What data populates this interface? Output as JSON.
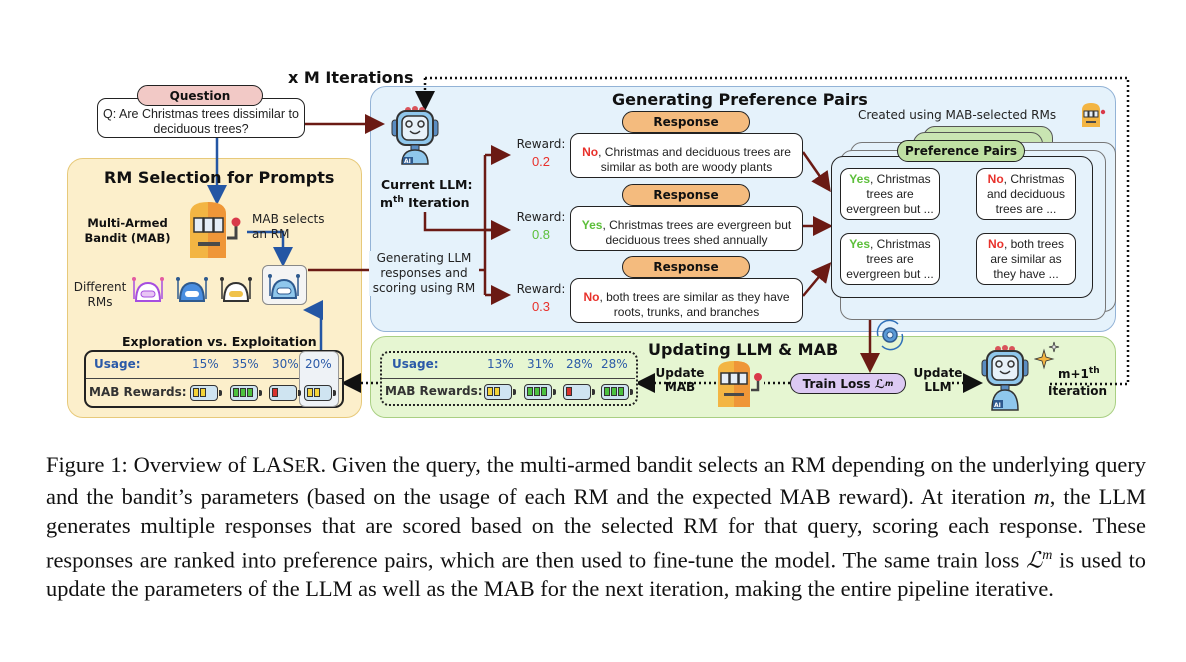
{
  "figure": {
    "loop_label": "x M Iterations",
    "question": {
      "header": "Question",
      "text": "Q: Are Christmas trees dissimilar to deciduous trees?"
    },
    "rm_selection": {
      "title": "RM Selection for Prompts",
      "mab_label": "Multi-Armed Bandit (MAB)",
      "mab_selects": "MAB selects an RM",
      "different_rms": "Different RMs",
      "tradeoff_title": "Exploration vs. Exploitation",
      "usage_label": "Usage:",
      "rewards_label": "MAB Rewards:",
      "usage": [
        "15%",
        "35%",
        "30%",
        "20%"
      ],
      "reward_levels": [
        2,
        3,
        1,
        2
      ],
      "selected_index": 3
    },
    "generation": {
      "title": "Generating Preference Pairs",
      "current_llm_line1": "Current LLM:",
      "current_llm_line2": "m",
      "current_llm_sup": "th",
      "current_llm_line3": " Iteration",
      "generating_label": "Generating LLM responses and scoring using RM",
      "reward_label": "Reward:",
      "responses": [
        {
          "header": "Response",
          "verdict": "No",
          "rest": ", Christmas and deciduous trees are similar as both are woody plants",
          "reward": "0.2",
          "reward_color": "#e8312b"
        },
        {
          "header": "Response",
          "verdict": "Yes",
          "rest": ", Christmas trees are evergreen but deciduous trees shed annually",
          "reward": "0.8",
          "reward_color": "#5cbf3a"
        },
        {
          "header": "Response",
          "verdict": "No",
          "rest": ", both trees are similar as they have roots, trunks, and branches",
          "reward": "0.3",
          "reward_color": "#e8312b"
        }
      ],
      "created_note": "Created using MAB-selected RMs",
      "pairs_header": "Preference Pairs",
      "pairs": [
        {
          "verdict": "Yes",
          "rest": ", Christmas trees are evergreen but ..."
        },
        {
          "verdict": "No",
          "rest": ", Christmas and deciduous trees are ..."
        },
        {
          "verdict": "Yes",
          "rest": ", Christmas trees are evergreen but ..."
        },
        {
          "verdict": "No",
          "rest": ", both trees are similar as they have ..."
        }
      ]
    },
    "update": {
      "title": "Updating LLM & MAB",
      "usage_label": "Usage:",
      "rewards_label": "MAB Rewards:",
      "usage": [
        "13%",
        "31%",
        "28%",
        "28%"
      ],
      "reward_levels": [
        2,
        3,
        1,
        3
      ],
      "update_mab": "Update MAB",
      "train_loss": "Train Loss ℒ",
      "train_loss_sup": "m",
      "update_llm": "Update LLM",
      "next_iter_line1": "m+1",
      "next_iter_sup": "th",
      "next_iter_line2": "Iteration"
    }
  },
  "caption": {
    "prefix": "Figure 1: Overview of ",
    "name_a": "LAS",
    "name_b": "E",
    "name_c": "R",
    "body1": ". Given the query, the multi-armed bandit selects an RM depending on the underlying query and the bandit’s parameters (based on the usage of each RM and the expected MAB reward). At iteration ",
    "m": "m",
    "body2": ", the LLM generates multiple responses that are scored based on the selected RM for that query, scoring each response. These responses are ranked into preference pairs, which are then used to fine-tune the model. The same train loss ",
    "loss": "ℒ",
    "loss_sup": "m",
    "body3": " is used to update the parameters of the LLM as well as the MAB for the next iteration, making the entire pipeline iterative."
  },
  "colors": {
    "arrow_dark_red": "#6b1a14",
    "arrow_blue": "#2456a4",
    "usage_blue": "#2b5aa8",
    "yes_green": "#5cbf3a",
    "no_red": "#e8312b",
    "response_header": "#f4bb7e",
    "pairs_header": "#bfe0a3",
    "question_header": "#f2c9c6",
    "train_loss": "#dcc9f3"
  }
}
